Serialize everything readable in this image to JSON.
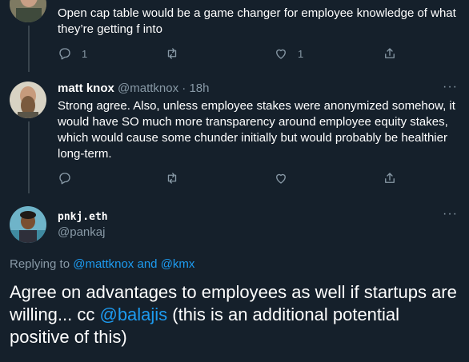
{
  "tweet1": {
    "text_line1": "Open cap table would be a game changer for employee knowledge of what",
    "text_line2": "they’re getting f into",
    "reply_count": "1",
    "like_count": "1"
  },
  "tweet2": {
    "name": "matt knox",
    "handle": "@mattknox",
    "dot": "·",
    "time": "18h",
    "more": "···",
    "text_lines": [
      "Strong agree.  Also, unless employee stakes were anonymized somehow, it",
      "would have SO much more transparency around employee equity stakes,",
      "which would cause some chunder initially but would probably be healthier",
      "long-term."
    ]
  },
  "main_tweet": {
    "name": "pnkj.eth",
    "handle": "@pankaj",
    "more": "···",
    "replying_prefix": "Replying to",
    "reply_to_1": "@mattknox",
    "reply_and": "and",
    "reply_to_2": "@kmx",
    "text_part1": "Agree on advantages to employees as well if startups are willing... cc ",
    "mention": "@balajis",
    "text_part2": " (this is an additional potential positive of this)"
  },
  "icons": {
    "reply": "reply-icon",
    "retweet": "retweet-icon",
    "like": "like-icon",
    "share": "share-icon"
  },
  "colors": {
    "background": "#15202b",
    "text_secondary": "#8899a6",
    "link": "#1d9bf0",
    "divider": "#38444d"
  }
}
